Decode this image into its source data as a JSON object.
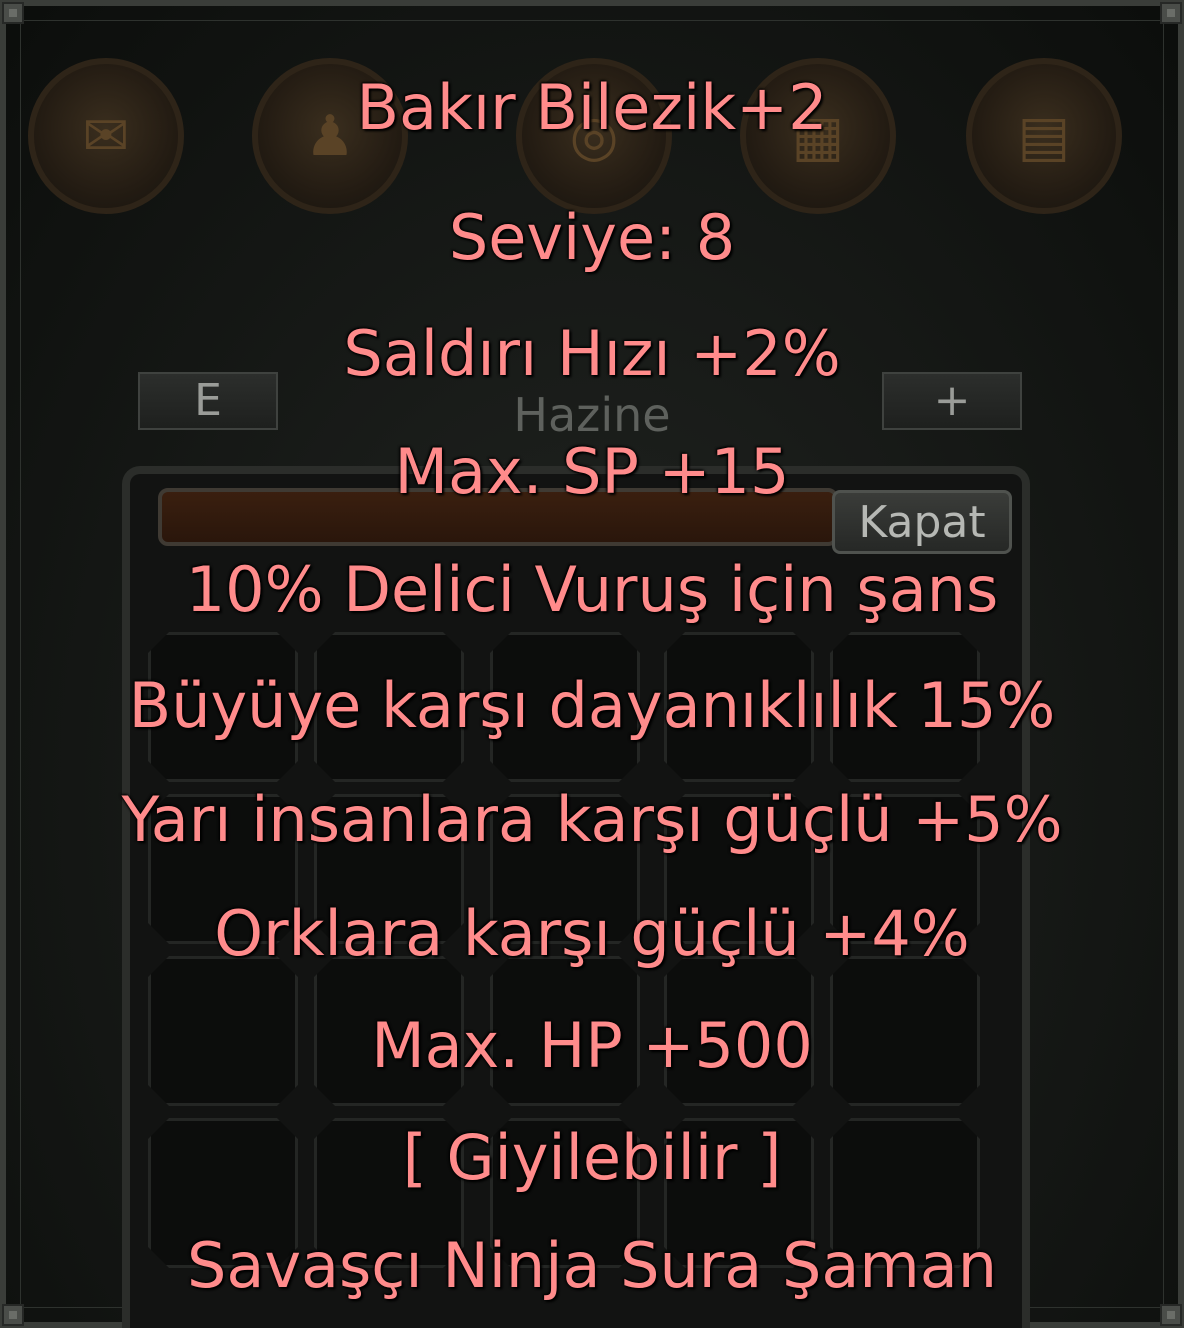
{
  "window": {
    "section_title": "Hazine",
    "left_button_label": "E",
    "right_button_label": "+",
    "close_button_label": "Kapat"
  },
  "tooltip": {
    "item_name": "Bakır Bilezik+2",
    "level": "Seviye: 8",
    "attributes": [
      "Saldırı Hızı +2%",
      "Max. SP +15",
      "10% Delici Vuruş için şans",
      "Büyüye karşı dayanıklılık 15%",
      "Yarı insanlara karşı güçlü +5%",
      "Orklara karşı güçlü +4%",
      "Max. HP +500"
    ],
    "wearable": "[ Giyilebilir ]",
    "classes": "Savaşçı Ninja Sura Şaman",
    "text_color": "#ff8b8b"
  },
  "icons": [
    "envelope-icon",
    "people-icon",
    "circle-icon",
    "grid-icon",
    "document-icon"
  ]
}
